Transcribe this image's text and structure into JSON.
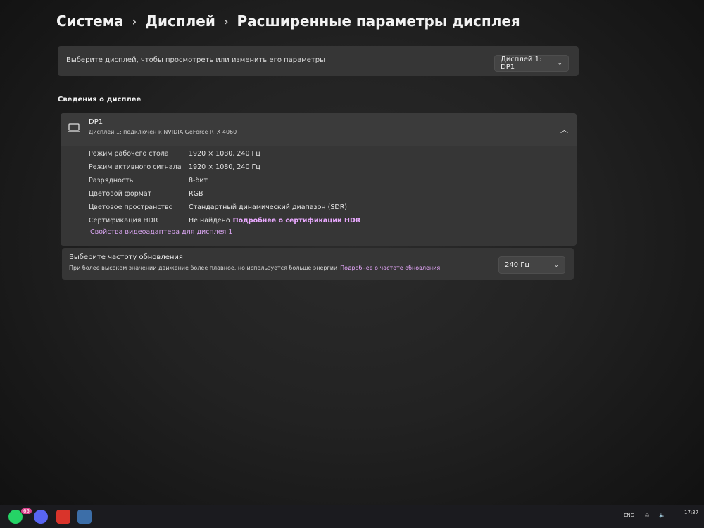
{
  "breadcrumb": {
    "items": [
      "Система",
      "Дисплей",
      "Расширенные параметры дисплея"
    ],
    "separator": "›"
  },
  "select_display": {
    "prompt": "Выберите дисплей, чтобы просмотреть или изменить его параметры",
    "selected": "Дисплей 1: DP1"
  },
  "section_title": "Сведения о дисплее",
  "display_info": {
    "name": "DP1",
    "subtitle": "Дисплей 1: подключен к NVIDIA GeForce RTX 4060",
    "rows": [
      {
        "label": "Режим рабочего стола",
        "value": "1920 × 1080, 240 Гц"
      },
      {
        "label": "Режим активного сигнала",
        "value": "1920 × 1080, 240 Гц"
      },
      {
        "label": "Разрядность",
        "value": "8-бит"
      },
      {
        "label": "Цветовой формат",
        "value": "RGB"
      },
      {
        "label": "Цветовое пространство",
        "value": "Стандартный динамический диапазон (SDR)"
      },
      {
        "label": "Сертификация HDR",
        "value": "Не найдено",
        "link": "Подробнее о сертификации HDR"
      }
    ],
    "adapter_link": "Свойства видеоадаптера для дисплея 1"
  },
  "refresh": {
    "title": "Выберите частоту обновления",
    "description": "При более высоком значении движение более плавное, но используется больше энергии",
    "link": "Подробнее о частоте обновления",
    "selected": "240 Гц"
  },
  "taskbar": {
    "badge": "65",
    "tray_lang": "ENG",
    "clock": "17:37"
  },
  "colors": {
    "accent_link": "#e9a9ff",
    "card": "#363636"
  }
}
